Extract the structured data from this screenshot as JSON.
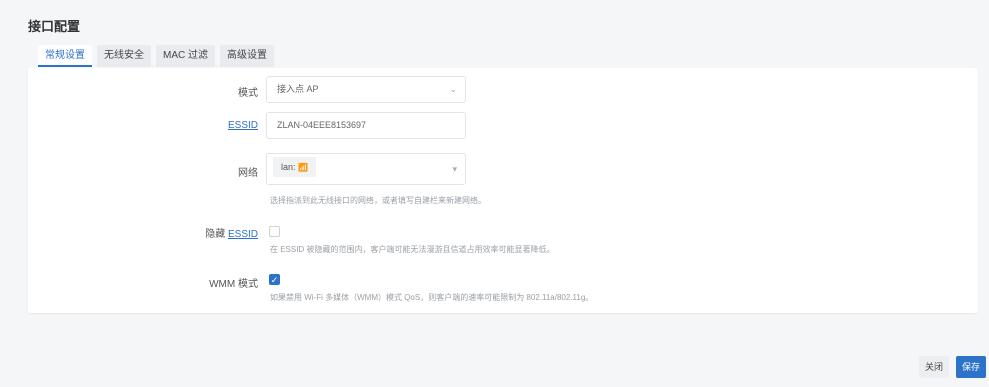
{
  "page": {
    "title": "接口配置"
  },
  "tabs": [
    {
      "label": "常规设置",
      "active": true
    },
    {
      "label": "无线安全",
      "active": false
    },
    {
      "label": "MAC 过滤",
      "active": false
    },
    {
      "label": "高级设置",
      "active": false
    }
  ],
  "form": {
    "mode": {
      "label": "模式",
      "value": "接入点 AP"
    },
    "essid": {
      "label": "ESSID",
      "value": "ZLAN-04EEE8153697"
    },
    "network": {
      "label": "网络",
      "value": "lan:",
      "hint": "选择指派到此无线接口的网络，或者填写自建栏来新建网络。"
    },
    "hide_essid": {
      "label_prefix": "隐藏",
      "label_link": "ESSID",
      "checked": false,
      "hint": "在 ESSID 被隐藏的范围内，客户端可能无法漫游且信道占用效率可能显著降低。"
    },
    "wmm": {
      "label": "WMM 模式",
      "checked": true,
      "hint": "如果禁用 Wi-Fi 多媒体（WMM）模式 QoS，则客户端的速率可能限制为 802.11a/802.11g。"
    }
  },
  "buttons": {
    "close": "关闭",
    "save": "保存"
  },
  "colors": {
    "accent": "#2b72c8",
    "background": "#f5f6f8"
  }
}
